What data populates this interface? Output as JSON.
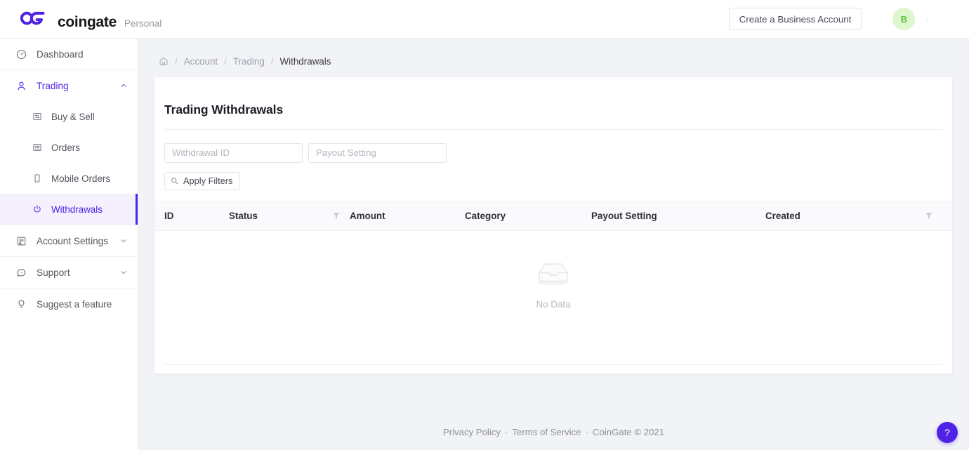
{
  "header": {
    "brand_name": "coingate",
    "brand_sub": "Personal",
    "logo_icon": "coingate-cg-logo",
    "business_button": "Create a Business Account",
    "avatar_initial": "B",
    "avatar_bg": "#ddf7cf",
    "avatar_fg": "#63c242",
    "user_name": "-"
  },
  "sidebar": {
    "groups": [
      {
        "items": [
          {
            "label": "Dashboard",
            "icon": "dashboard-gauge-icon",
            "state": "default",
            "level": "top"
          }
        ]
      },
      {
        "items": [
          {
            "label": "Trading",
            "icon": "user-icon",
            "state": "open",
            "level": "top",
            "chevron": "chevron-up-icon"
          },
          {
            "label": "Buy & Sell",
            "icon": "exchange-card-icon",
            "state": "default",
            "level": "sub"
          },
          {
            "label": "Orders",
            "icon": "list-card-icon",
            "state": "default",
            "level": "sub"
          },
          {
            "label": "Mobile Orders",
            "icon": "mobile-icon",
            "state": "default",
            "level": "sub"
          },
          {
            "label": "Withdrawals",
            "icon": "power-icon",
            "state": "active",
            "level": "sub"
          }
        ]
      },
      {
        "items": [
          {
            "label": "Account Settings",
            "icon": "account-settings-icon",
            "state": "default",
            "level": "top",
            "chevron": "chevron-down-icon"
          }
        ]
      },
      {
        "items": [
          {
            "label": "Support",
            "icon": "chat-bubble-icon",
            "state": "default",
            "level": "top",
            "chevron": "chevron-down-icon"
          }
        ]
      },
      {
        "items": [
          {
            "label": "Suggest a feature",
            "icon": "lightbulb-icon",
            "state": "default",
            "level": "top"
          }
        ]
      }
    ]
  },
  "breadcrumb": {
    "home_icon": "home-icon",
    "separator": "/",
    "items": [
      {
        "label": "Account",
        "current": false
      },
      {
        "label": "Trading",
        "current": false
      },
      {
        "label": "Withdrawals",
        "current": true
      }
    ]
  },
  "page": {
    "title": "Trading Withdrawals"
  },
  "filters": {
    "withdrawal_id": {
      "value": "",
      "placeholder": "Withdrawal ID"
    },
    "payout_setting": {
      "value": "",
      "placeholder": "Payout Setting"
    },
    "apply_button": "Apply Filters",
    "apply_icon": "search-icon"
  },
  "table": {
    "columns": [
      {
        "label": "ID",
        "filter": false
      },
      {
        "label": "Status",
        "filter": true
      },
      {
        "label": "Amount",
        "filter": false
      },
      {
        "label": "Category",
        "filter": false
      },
      {
        "label": "Payout Setting",
        "filter": false
      },
      {
        "label": "Created",
        "filter": true
      }
    ],
    "rows": [],
    "empty_icon": "empty-inbox-icon",
    "empty_label": "No Data"
  },
  "footer": {
    "privacy": "Privacy Policy",
    "terms": "Terms of Service",
    "copyright": "CoinGate © 2021",
    "separator": "·"
  },
  "help": {
    "label": "?",
    "icon": "question-mark-icon",
    "color": "#4f22e6"
  }
}
